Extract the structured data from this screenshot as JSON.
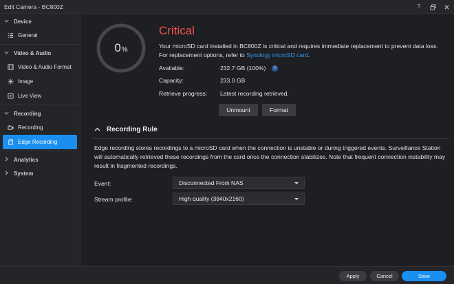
{
  "window": {
    "title": "Edit Camera - BC800Z"
  },
  "sidebar": {
    "sections": [
      {
        "label": "Device",
        "items": [
          {
            "label": "General",
            "icon": "list-icon"
          }
        ]
      },
      {
        "label": "Video & Audio",
        "items": [
          {
            "label": "Video & Audio Format",
            "icon": "film-icon"
          },
          {
            "label": "Image",
            "icon": "sun-icon"
          },
          {
            "label": "Live View",
            "icon": "play-icon"
          }
        ]
      },
      {
        "label": "Recording",
        "items": [
          {
            "label": "Recording",
            "icon": "camera-icon"
          },
          {
            "label": "Edge Recording",
            "icon": "sdcard-icon",
            "active": true
          }
        ]
      },
      {
        "label": "Analytics",
        "items": []
      },
      {
        "label": "System",
        "items": []
      }
    ]
  },
  "storage": {
    "usage_value": "0",
    "usage_unit": "%",
    "usage_fraction": 0.0,
    "status": "Critical",
    "status_color": "#f05252",
    "desc_main": "Your microSD card installed in BC800Z is critical and requires immediate replacement to prevent data loss. For replacement options, refer to ",
    "desc_link": "Synology microSD card",
    "desc_end": ".",
    "available_label": "Available:",
    "available_value": "232.7 GB (100%)",
    "capacity_label": "Capacity:",
    "capacity_value": "233.0 GB",
    "retrieve_label": "Retrieve progress:",
    "retrieve_value": "Latest recording retrieved.",
    "unmount_label": "Unmount",
    "format_label": "Format"
  },
  "rule": {
    "title": "Recording Rule",
    "description": "Edge recording stores recordings to a microSD card when the connection is unstable or during triggered events. Surveillance Station will automatically retrieved these recordings from the card once the connection stabilizes. Note that frequent connection instability may result in fragmented recordings.",
    "event_label": "Event:",
    "event_value": "Disconnected From NAS",
    "stream_label": "Stream profile:",
    "stream_value": "High quality (3840x2160)"
  },
  "footer": {
    "apply": "Apply",
    "cancel": "Cancel",
    "save": "Save"
  },
  "colors": {
    "accent": "#1a8ff0",
    "critical": "#f05252",
    "link": "#2e9bf0"
  }
}
